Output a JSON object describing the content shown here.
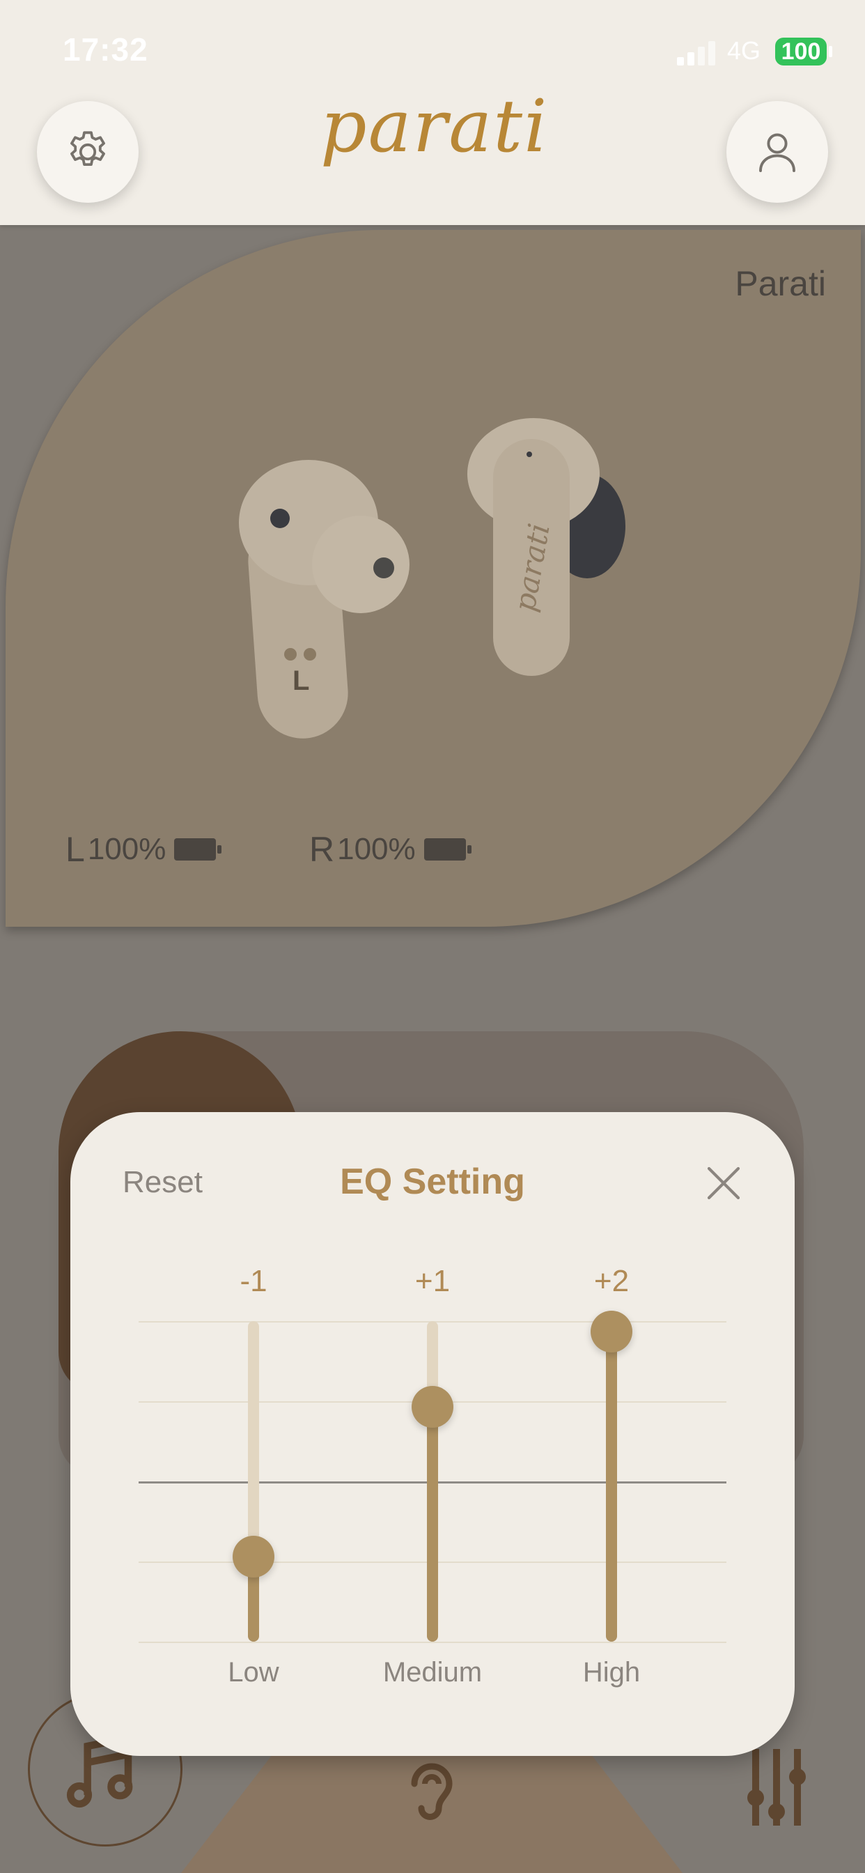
{
  "status_bar": {
    "time": "17:32",
    "network": "4G",
    "battery": "100",
    "battery_color": "#33c25a"
  },
  "header": {
    "logo": "parati",
    "settings_icon": "gear-icon",
    "profile_icon": "user-icon",
    "accent": "#b88736"
  },
  "device": {
    "name": "Parati",
    "left": {
      "side": "L",
      "level": "100%"
    },
    "right": {
      "side": "R",
      "level": "100%"
    },
    "bud_marking_left": "L",
    "bud_marking_right": "parati"
  },
  "eq": {
    "reset_label": "Reset",
    "title": "EQ Setting",
    "close_icon": "close-icon",
    "bands": [
      {
        "label": "Low",
        "value": "-1",
        "level": -1
      },
      {
        "label": "Medium",
        "value": "+1",
        "level": 1
      },
      {
        "label": "High",
        "value": "+2",
        "level": 2
      }
    ],
    "range": [
      -2,
      2
    ],
    "accent": "#ad9060"
  },
  "nav": {
    "items": [
      "music-note-icon",
      "ear-icon",
      "equalizer-sliders-icon"
    ]
  }
}
